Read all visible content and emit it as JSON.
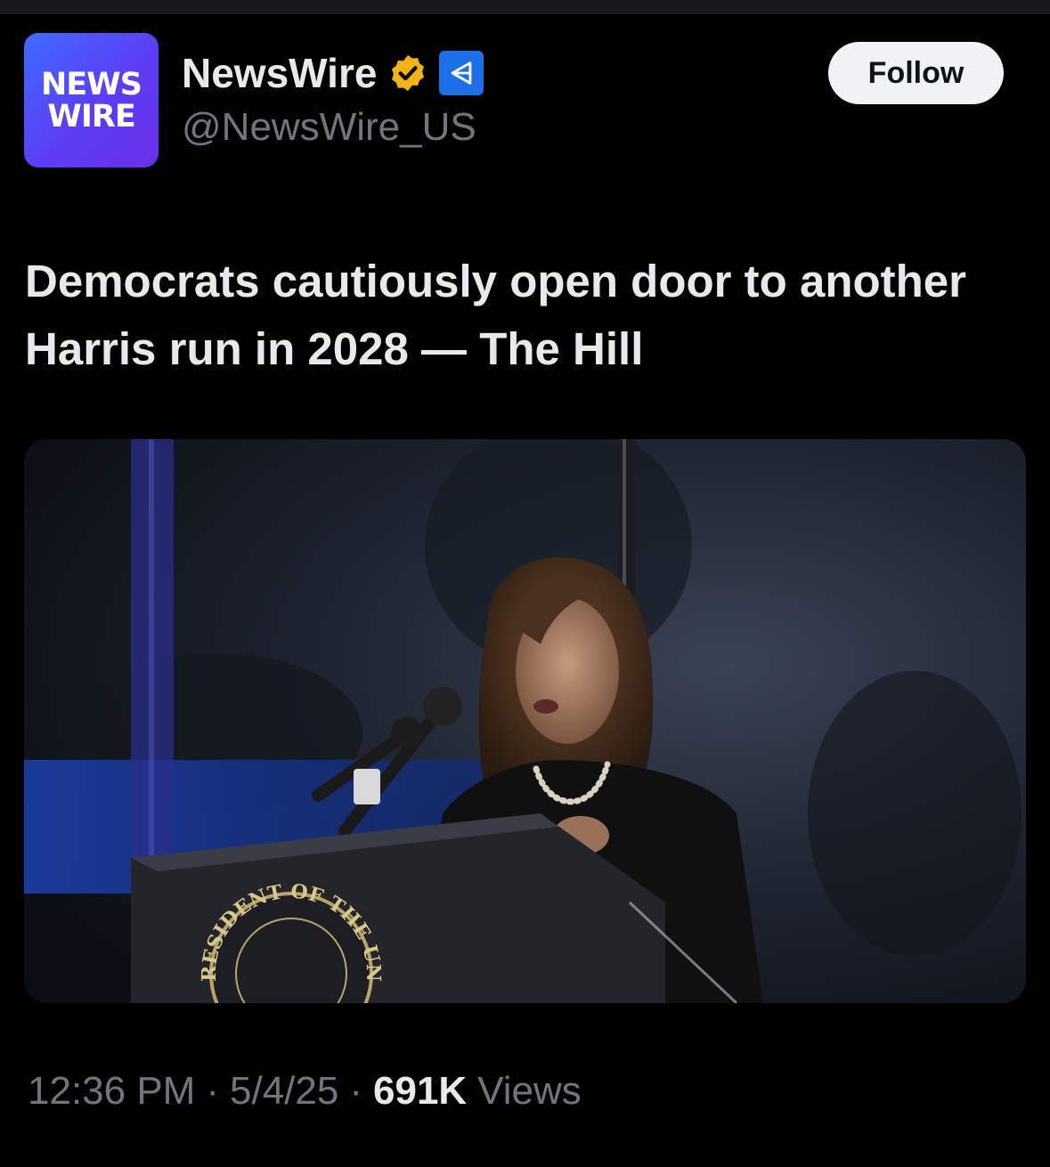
{
  "account": {
    "avatar_line1": "NEWS",
    "avatar_line2": "WIRE",
    "display_name": "NewsWire",
    "handle": "@NewsWire_US",
    "verified_badge": "gold-checkmark-icon",
    "affiliate_badge": "affiliate-badge-icon"
  },
  "follow_label": "Follow",
  "headline": "Democrats cautiously open door to another Harris run in 2028 — The Hill",
  "photo": {
    "podium_seal_text": "RESIDENT OF THE UN"
  },
  "meta": {
    "time": "12:36 PM",
    "sep1": "·",
    "date": "5/4/25",
    "sep2": "·",
    "views_count": "691K",
    "views_label": "Views"
  },
  "colors": {
    "background": "#000000",
    "text": "#e7e9ea",
    "muted": "#71767b",
    "gold_badge": "#f2b318",
    "affiliate_blue": "#1d6fe8"
  }
}
